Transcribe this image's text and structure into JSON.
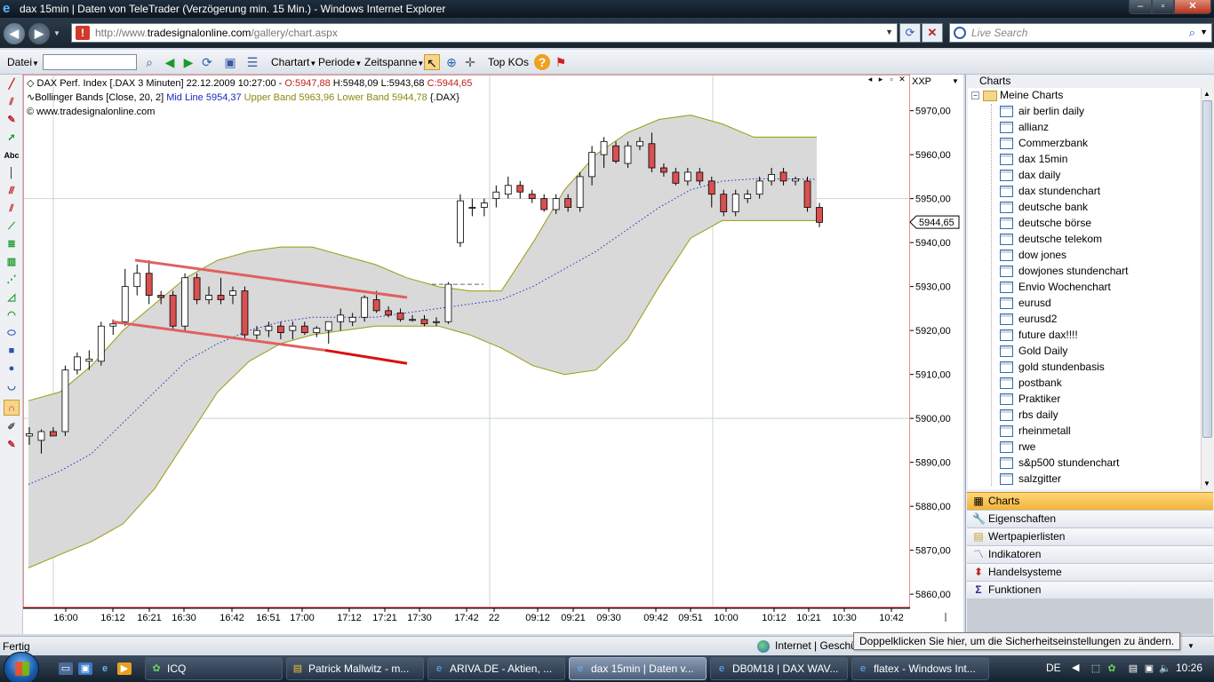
{
  "window": {
    "title": "dax 15min | Daten von TeleTrader (Verzögerung min. 15 Min.) - Windows Internet Explorer"
  },
  "addressbar": {
    "url_prefix": "http://www.",
    "url_domain": "tradesignalonline.com",
    "url_path": "/gallery/chart.aspx",
    "search_placeholder": "Live Search"
  },
  "toolbar": {
    "file_menu": "Datei",
    "charttype_menu": "Chartart",
    "period_menu": "Periode",
    "timescale_menu": "Zeitspanne",
    "top_kos": "Top KOs",
    "symbol_value": ""
  },
  "chart_header": {
    "instrument": "DAX Perf. Index [.DAX  3 Minuten] 22.12.2009 10:27:00 - ",
    "open": "O:5947,88",
    "high_low": " H:5948,09 L:5943,68 ",
    "close": "C:5944,65",
    "indicator": "Bollinger Bands [Close, 20, 2] ",
    "mid_line": "Mid Line 5954,37",
    "upper_band": " Upper Band 5963,96",
    "lower_band": " Lower Band 5944,78",
    "indicator_suffix": " {.DAX}",
    "copyright": "© www.tradesignalonline.com",
    "scale_mode": "XXP",
    "last_price_label": "5944,65"
  },
  "colors": {
    "bull_candle": "#ffffff",
    "bear_candle": "#d95050",
    "band_fill": "#d9d9d9",
    "band_line": "#9a9a10",
    "mid_line": "#2a2ad0",
    "trendline": "#e06060"
  },
  "chart_data": {
    "type": "candlestick",
    "y_ticks": [
      "5970,00",
      "5960,00",
      "5950,00",
      "5940,00",
      "5930,00",
      "5920,00",
      "5910,00",
      "5900,00",
      "5890,00",
      "5880,00",
      "5870,00",
      "5860,00"
    ],
    "ylim": [
      5857,
      5977
    ],
    "x_ticks": [
      "16:00",
      "16:12",
      "16:21",
      "16:30",
      "16:42",
      "16:51",
      "17:00",
      "17:12",
      "17:21",
      "17:30",
      "17:42",
      "22",
      "09:12",
      "09:21",
      "09:30",
      "09:42",
      "09:51",
      "10:00",
      "10:12",
      "10:21",
      "10:30",
      "10:42"
    ],
    "candles": [
      {
        "o": 5896.0,
        "h": 5898.0,
        "l": 5894.0,
        "c": 5896.5
      },
      {
        "o": 5895.0,
        "h": 5897.5,
        "l": 5892.0,
        "c": 5897.0
      },
      {
        "o": 5897.0,
        "h": 5898.0,
        "l": 5896.0,
        "c": 5896.0
      },
      {
        "o": 5897.0,
        "h": 5912.0,
        "l": 5896.0,
        "c": 5911.0
      },
      {
        "o": 5911.0,
        "h": 5915.0,
        "l": 5910.0,
        "c": 5914.0
      },
      {
        "o": 5913.0,
        "h": 5915.5,
        "l": 5911.0,
        "c": 5913.5
      },
      {
        "o": 5913.0,
        "h": 5922.0,
        "l": 5912.0,
        "c": 5921.0
      },
      {
        "o": 5921.0,
        "h": 5922.5,
        "l": 5919.0,
        "c": 5921.5
      },
      {
        "o": 5922.0,
        "h": 5934.0,
        "l": 5921.0,
        "c": 5930.0
      },
      {
        "o": 5930.0,
        "h": 5935.0,
        "l": 5928.0,
        "c": 5933.0
      },
      {
        "o": 5933.0,
        "h": 5936.0,
        "l": 5926.0,
        "c": 5928.0
      },
      {
        "o": 5928.0,
        "h": 5929.0,
        "l": 5926.0,
        "c": 5927.5
      },
      {
        "o": 5928.0,
        "h": 5929.0,
        "l": 5920.0,
        "c": 5921.0
      },
      {
        "o": 5921.0,
        "h": 5933.0,
        "l": 5920.0,
        "c": 5932.0
      },
      {
        "o": 5932.0,
        "h": 5933.0,
        "l": 5926.0,
        "c": 5927.0
      },
      {
        "o": 5927.0,
        "h": 5930.0,
        "l": 5926.0,
        "c": 5928.0
      },
      {
        "o": 5928.0,
        "h": 5932.0,
        "l": 5926.0,
        "c": 5927.0
      },
      {
        "o": 5928.0,
        "h": 5930.0,
        "l": 5926.0,
        "c": 5929.0
      },
      {
        "o": 5929.0,
        "h": 5930.0,
        "l": 5918.0,
        "c": 5919.0
      },
      {
        "o": 5919.0,
        "h": 5921.0,
        "l": 5918.0,
        "c": 5920.0
      },
      {
        "o": 5920.0,
        "h": 5922.0,
        "l": 5918.5,
        "c": 5921.0
      },
      {
        "o": 5921.0,
        "h": 5922.0,
        "l": 5918.0,
        "c": 5919.5
      },
      {
        "o": 5920.0,
        "h": 5922.0,
        "l": 5918.0,
        "c": 5921.0
      },
      {
        "o": 5921.0,
        "h": 5922.0,
        "l": 5919.0,
        "c": 5919.5
      },
      {
        "o": 5919.5,
        "h": 5921.0,
        "l": 5918.5,
        "c": 5920.5
      },
      {
        "o": 5920.0,
        "h": 5922.0,
        "l": 5917.0,
        "c": 5922.0
      },
      {
        "o": 5922.0,
        "h": 5925.0,
        "l": 5920.0,
        "c": 5923.5
      },
      {
        "o": 5922.0,
        "h": 5924.0,
        "l": 5921.0,
        "c": 5923.0
      },
      {
        "o": 5923.0,
        "h": 5928.0,
        "l": 5922.0,
        "c": 5927.5
      },
      {
        "o": 5927.0,
        "h": 5929.0,
        "l": 5924.0,
        "c": 5924.5
      },
      {
        "o": 5924.5,
        "h": 5925.5,
        "l": 5923.0,
        "c": 5923.5
      },
      {
        "o": 5924.0,
        "h": 5925.0,
        "l": 5922.0,
        "c": 5922.5
      },
      {
        "o": 5922.5,
        "h": 5923.5,
        "l": 5922.0,
        "c": 5922.5
      },
      {
        "o": 5922.5,
        "h": 5923.5,
        "l": 5921.0,
        "c": 5921.5
      },
      {
        "o": 5922.0,
        "h": 5923.0,
        "l": 5921.0,
        "c": 5922.0
      },
      {
        "o": 5922.0,
        "h": 5931.0,
        "l": 5921.5,
        "c": 5930.5
      },
      {
        "o": 5940.0,
        "h": 5951.0,
        "l": 5939.0,
        "c": 5949.5
      },
      {
        "o": 5948.0,
        "h": 5950.0,
        "l": 5946.0,
        "c": 5948.0
      },
      {
        "o": 5948.0,
        "h": 5950.0,
        "l": 5946.0,
        "c": 5949.0
      },
      {
        "o": 5950.0,
        "h": 5953.0,
        "l": 5948.0,
        "c": 5951.5
      },
      {
        "o": 5951.0,
        "h": 5955.0,
        "l": 5950.0,
        "c": 5953.0
      },
      {
        "o": 5953.0,
        "h": 5954.0,
        "l": 5950.0,
        "c": 5951.5
      },
      {
        "o": 5951.0,
        "h": 5952.0,
        "l": 5949.0,
        "c": 5950.0
      },
      {
        "o": 5950.0,
        "h": 5951.0,
        "l": 5947.0,
        "c": 5947.5
      },
      {
        "o": 5947.5,
        "h": 5951.0,
        "l": 5946.5,
        "c": 5950.0
      },
      {
        "o": 5950.0,
        "h": 5951.0,
        "l": 5947.0,
        "c": 5948.0
      },
      {
        "o": 5948.0,
        "h": 5956.0,
        "l": 5947.0,
        "c": 5955.0
      },
      {
        "o": 5955.0,
        "h": 5962.0,
        "l": 5953.0,
        "c": 5960.5
      },
      {
        "o": 5960.0,
        "h": 5964.0,
        "l": 5957.0,
        "c": 5963.0
      },
      {
        "o": 5962.0,
        "h": 5963.0,
        "l": 5958.0,
        "c": 5958.5
      },
      {
        "o": 5958.0,
        "h": 5963.0,
        "l": 5957.0,
        "c": 5962.0
      },
      {
        "o": 5962.0,
        "h": 5964.0,
        "l": 5961.0,
        "c": 5963.0
      },
      {
        "o": 5962.5,
        "h": 5965.0,
        "l": 5956.0,
        "c": 5957.0
      },
      {
        "o": 5957.0,
        "h": 5958.0,
        "l": 5955.0,
        "c": 5956.0
      },
      {
        "o": 5956.0,
        "h": 5957.0,
        "l": 5953.0,
        "c": 5953.5
      },
      {
        "o": 5954.0,
        "h": 5957.0,
        "l": 5953.0,
        "c": 5956.0
      },
      {
        "o": 5956.0,
        "h": 5957.0,
        "l": 5953.0,
        "c": 5954.0
      },
      {
        "o": 5954.0,
        "h": 5955.0,
        "l": 5948.0,
        "c": 5951.0
      },
      {
        "o": 5951.0,
        "h": 5952.0,
        "l": 5946.0,
        "c": 5947.0
      },
      {
        "o": 5947.0,
        "h": 5952.0,
        "l": 5946.0,
        "c": 5951.0
      },
      {
        "o": 5950.0,
        "h": 5952.0,
        "l": 5949.0,
        "c": 5951.0
      },
      {
        "o": 5951.0,
        "h": 5955.0,
        "l": 5950.0,
        "c": 5954.0
      },
      {
        "o": 5954.0,
        "h": 5957.0,
        "l": 5953.0,
        "c": 5955.5
      },
      {
        "o": 5956.0,
        "h": 5957.0,
        "l": 5953.0,
        "c": 5954.0
      },
      {
        "o": 5954.0,
        "h": 5955.0,
        "l": 5953.0,
        "c": 5954.5
      },
      {
        "o": 5954.0,
        "h": 5955.0,
        "l": 5947.0,
        "c": 5948.0
      },
      {
        "o": 5948.0,
        "h": 5949.0,
        "l": 5943.5,
        "c": 5944.6
      }
    ],
    "bollinger_upper": [
      5904,
      5906,
      5912,
      5920,
      5926,
      5932,
      5936,
      5938,
      5939,
      5939,
      5937,
      5935,
      5932,
      5930,
      5929,
      5929,
      5940,
      5952,
      5960,
      5965,
      5968,
      5969,
      5967,
      5964,
      5964,
      5964
    ],
    "bollinger_lower": [
      5866,
      5869,
      5872,
      5876,
      5884,
      5895,
      5906,
      5913,
      5917,
      5919,
      5920,
      5921,
      5921,
      5921,
      5919,
      5916,
      5912,
      5910,
      5911,
      5918,
      5930,
      5941,
      5945,
      5945,
      5945,
      5945
    ],
    "bollinger_mid": [
      5885,
      5888,
      5892,
      5899,
      5906,
      5913,
      5917,
      5920,
      5922,
      5923,
      5923,
      5923,
      5924,
      5925,
      5926,
      5927,
      5930,
      5934,
      5938,
      5943,
      5948,
      5952,
      5954,
      5954.5,
      5954.5,
      5954.4
    ]
  },
  "sidepanel": {
    "title": "Charts",
    "root_folder": "Meine Charts",
    "items": [
      "air berlin daily",
      "allianz",
      "Commerzbank",
      "dax 15min",
      "dax daily",
      "dax stundenchart",
      "deutsche bank",
      "deutsche börse",
      "deutsche telekom",
      "dow jones",
      "dowjones stundenchart",
      "Envio Wochenchart",
      "eurusd",
      "eurusd2",
      "future dax!!!!",
      "Gold Daily",
      "gold stundenbasis",
      "postbank",
      "Praktiker",
      "rbs daily",
      "rheinmetall",
      "rwe",
      "s&p500 stundenchart",
      "salzgitter"
    ],
    "tabs": [
      "Charts",
      "Eigenschaften",
      "Wertpapierlisten",
      "Indikatoren",
      "Handelsysteme",
      "Funktionen"
    ]
  },
  "statusbar": {
    "status": "Fertig",
    "zone": "Internet | Geschü",
    "tooltip": "Doppelklicken Sie hier, um die Sicherheitseinstellungen zu ändern."
  },
  "taskbar": {
    "tasks": [
      "ICQ",
      "Patrick Mallwitz - m...",
      "ARIVA.DE - Aktien, ...",
      "dax 15min | Daten v...",
      "DB0M18 | DAX WAV...",
      "flatex - Windows Int..."
    ],
    "language": "DE",
    "clock": "10:26"
  }
}
